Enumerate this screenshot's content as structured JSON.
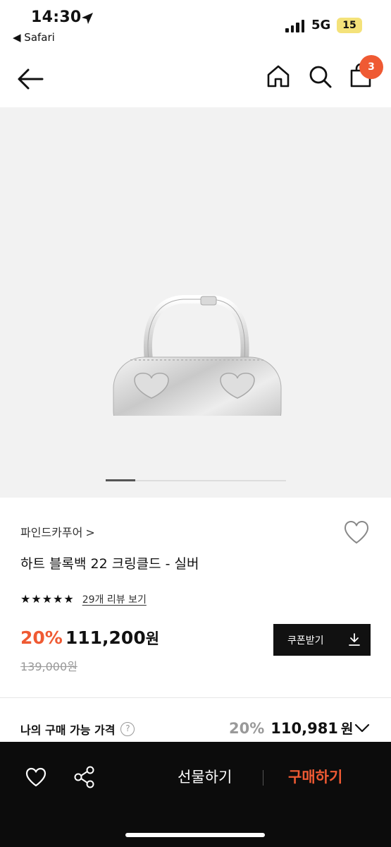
{
  "status_bar": {
    "time": "14:30",
    "back_app": "◀ Safari",
    "network": "5G",
    "battery": "15"
  },
  "nav": {
    "cart_count": "3"
  },
  "product": {
    "brand": "파인드카푸어",
    "brand_chevron": ">",
    "title": "하트 블록백 22 크링클드 - 실버",
    "stars": [
      "★",
      "★",
      "★",
      "★",
      "★"
    ],
    "rating": 5,
    "review_link": "29개 리뷰 보기",
    "discount": "20%",
    "price": "111,200",
    "currency": "원",
    "original_price": "139,000원",
    "coupon_label": "쿠폰받기",
    "gallery_position": 1
  },
  "my_price": {
    "label": "나의 구매 가능 가격",
    "help": "?",
    "discount": "20%",
    "amount": "110,981",
    "currency": "원"
  },
  "bottom_bar": {
    "gift_label": "선물하기",
    "buy_label": "구매하기"
  },
  "colors": {
    "accent": "#ef5a33",
    "bottom_bar": "#0c0c0c",
    "gallery_bg": "#f2f2f2"
  },
  "icons": [
    "back-arrow-icon",
    "home-icon",
    "search-icon",
    "shopping-bag-icon",
    "heart-icon",
    "share-icon",
    "download-icon",
    "chevron-down-icon",
    "location-arrow-icon"
  ]
}
